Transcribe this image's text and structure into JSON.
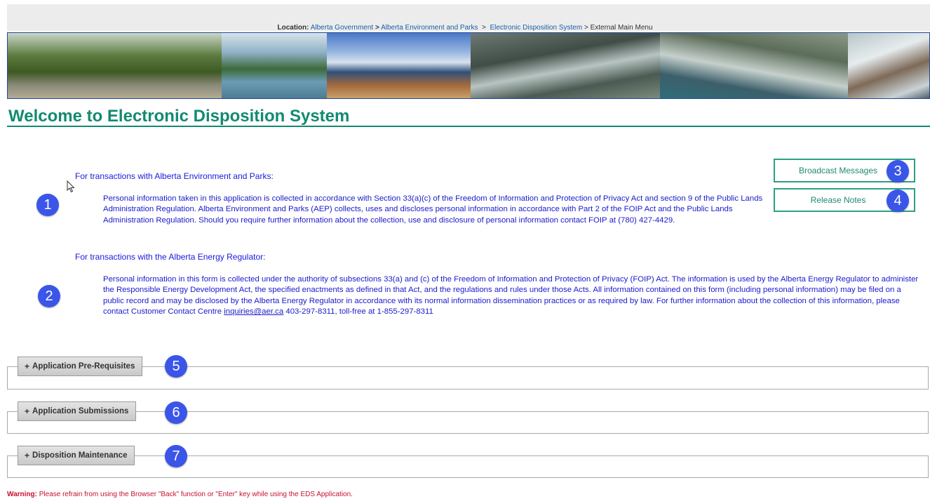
{
  "location": {
    "label": "Location:",
    "crumbs": [
      "Alberta Government",
      "Alberta Environment and Parks",
      "Electronic Disposition System"
    ],
    "separator": ">",
    "current": "External Main Menu"
  },
  "banner": {
    "segments": [
      "forest-road-photo",
      "lake-photo",
      "boardwalk-photo",
      "rock-creek-photo",
      "canyon-waterfall-photo",
      "ice-cliff-photo"
    ]
  },
  "page_title": "Welcome to Electronic Disposition System",
  "aep": {
    "heading": "For transactions with Alberta Environment and Parks:",
    "text": "Personal information taken in this application is collected in accordance with Section 33(a)(c) of the Freedom of Information and Protection of Privacy Act and section 9 of the Public Lands Administration Regulation. Alberta Environment and Parks (AEP) collects, uses and discloses personal information in accordance with Part 2 of the FOIP Act and the Public Lands Administration Regulation. Should you require further information about the collection, use and disclosure of personal information contact FOIP at (780) 427-4429."
  },
  "aer": {
    "heading": "For transactions with the Alberta Energy Regulator:",
    "text_before": "Personal information in this form is collected under the authority of subsections 33(a) and (c) of the Freedom of Information and Protection of Privacy (FOIP) Act. The information is used by the Alberta Energy Regulator to administer the Responsible Energy Development Act, the specified enactments as defined in that Act, and the regulations and rules under those Acts. All information contained on this form (including personal information) may be filed on a public record and may be disclosed by the Alberta Energy Regulator in accordance with its normal information dissemination practices or as required by law. For further information about the collection of this information, please contact Customer Contact Centre ",
    "email": "inquiries@aer.ca",
    "text_after": " 403-297-8311, toll-free at 1-855-297-8311"
  },
  "side_buttons": {
    "broadcast": "Broadcast Messages",
    "release_notes": "Release Notes"
  },
  "sections": [
    {
      "label": "Application Pre-Requisites",
      "expand_glyph": "+"
    },
    {
      "label": "Application Submissions",
      "expand_glyph": "+"
    },
    {
      "label": "Disposition Maintenance",
      "expand_glyph": "+"
    }
  ],
  "badges": [
    "1",
    "2",
    "3",
    "4",
    "5",
    "6",
    "7"
  ],
  "warning": {
    "label": "Warning:",
    "text": "Please refrain from using the Browser \"Back\" function or \"Enter\" key while using the EDS Application."
  },
  "colors": {
    "title_green": "#128a72",
    "link_blue": "#1a5fa8",
    "body_blue": "#1a1acc",
    "badge_blue": "#3a55e8",
    "warning_red": "#c8102e"
  }
}
